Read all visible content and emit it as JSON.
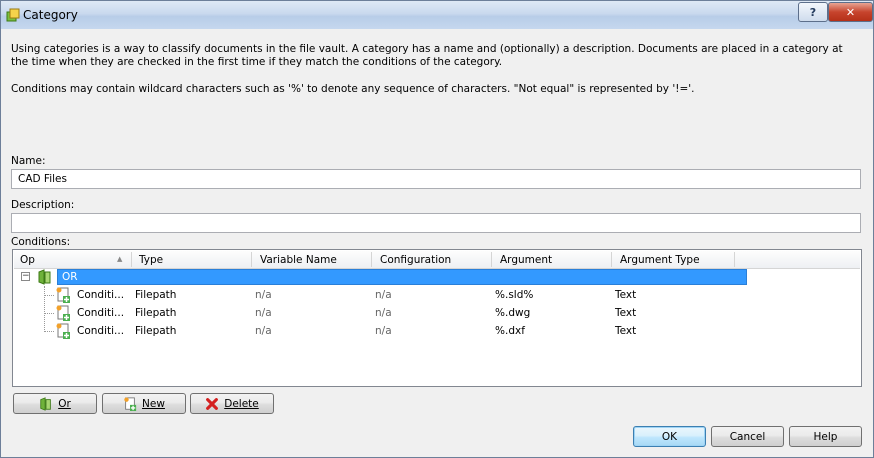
{
  "window": {
    "title": "Category",
    "help_label": "?",
    "close_label": "✕"
  },
  "intro": {
    "text1": "Using categories is a way to classify documents in the file vault. A category has a name and (optionally) a description. Documents are placed in a category at the time when they are checked in the first time if they match the conditions of the category.",
    "text2": "Conditions may contain wildcard characters such as '%' to denote any sequence of characters. \"Not equal\" is represented by '!='."
  },
  "form": {
    "name_label": "Name:",
    "name_value": "CAD Files",
    "description_label": "Description:",
    "description_value": "",
    "conditions_label": "Conditions:"
  },
  "grid": {
    "columns": [
      "Op",
      "Type",
      "Variable Name",
      "Configuration",
      "Argument",
      "Argument Type"
    ],
    "root": {
      "label": "OR"
    },
    "rows": [
      {
        "op": "Conditi...",
        "type": "Filepath",
        "variable": "n/a",
        "configuration": "n/a",
        "argument": "%.sld%",
        "argument_type": "Text"
      },
      {
        "op": "Conditi...",
        "type": "Filepath",
        "variable": "n/a",
        "configuration": "n/a",
        "argument": "%.dwg",
        "argument_type": "Text"
      },
      {
        "op": "Conditi...",
        "type": "Filepath",
        "variable": "n/a",
        "configuration": "n/a",
        "argument": "%.dxf",
        "argument_type": "Text"
      }
    ]
  },
  "buttons": {
    "or_label": "Or",
    "new_label": "New",
    "delete_label": "Delete",
    "ok_label": "OK",
    "cancel_label": "Cancel",
    "help_label": "Help"
  },
  "colors": {
    "selection": "#3399ff",
    "titlebar": "#c9d9ee",
    "close": "#c7442d"
  }
}
